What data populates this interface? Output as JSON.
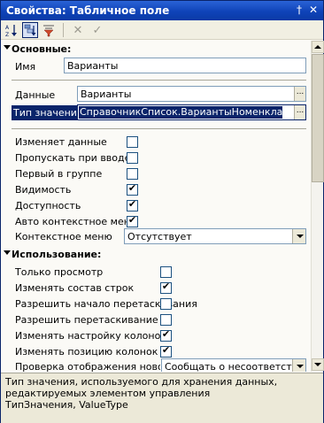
{
  "window": {
    "title": "Свойства: Табличное поле"
  },
  "titlebar_buttons": {
    "pin": "†",
    "close": "✕"
  },
  "toolbar": {
    "sort_label": "A↓Z",
    "filter_label": "▽",
    "cancel_label": "✕",
    "apply_label": "✓"
  },
  "sections": {
    "basic": "Основные:",
    "usage": "Использование:"
  },
  "basic": {
    "name": {
      "label": "Имя",
      "value": "Варианты"
    },
    "data": {
      "label": "Данные",
      "value": "Варианты"
    },
    "value_type": {
      "label": "Тип значения",
      "value": "СправочникСписок.ВариантыНоменклатуры"
    },
    "checks": [
      {
        "label": "Изменяет данные",
        "checked": false
      },
      {
        "label": "Пропускать при вводе",
        "checked": false
      },
      {
        "label": "Первый в группе",
        "checked": false
      },
      {
        "label": "Видимость",
        "checked": true
      },
      {
        "label": "Доступность",
        "checked": true
      },
      {
        "label": "Авто контекстное меню",
        "checked": true
      }
    ],
    "context_menu": {
      "label": "Контекстное меню",
      "value": "Отсутствует"
    }
  },
  "usage": {
    "checks": [
      {
        "label": "Только просмотр",
        "checked": false
      },
      {
        "label": "Изменять состав строк",
        "checked": true
      },
      {
        "label": "Разрешить начало перетаскивания",
        "checked": false
      },
      {
        "label": "Разрешить перетаскивание",
        "checked": false
      },
      {
        "label": "Изменять настройку колонок",
        "checked": true
      },
      {
        "label": "Изменять позицию колонок",
        "checked": true
      }
    ],
    "check_display": {
      "label": "Проверка отображения новой строки",
      "value": "Сообщать о несоответствии"
    }
  },
  "description": {
    "line1": "Тип значения, используемого для хранения данных,",
    "line2": "редактируемых элементом управления",
    "line3": "ТипЗначения, ValueType"
  },
  "glyphs": {
    "check": "✔",
    "dots": "..."
  }
}
